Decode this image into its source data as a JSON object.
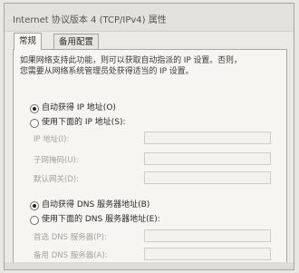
{
  "window": {
    "title": "Internet 协议版本 4 (TCP/IPv4) 属性"
  },
  "tabs": [
    {
      "label": "常规",
      "active": true
    },
    {
      "label": "备用配置",
      "active": false
    }
  ],
  "description": "如果网络支持此功能，则可以获取自动指派的 IP 设置。否则，\n您需要从网络系统管理员处获得适当的 IP 设置。",
  "ip": {
    "auto_label": "自动获得 IP 地址(O)",
    "auto_checked": true,
    "manual_label": "使用下面的 IP 地址(S):",
    "manual_checked": false,
    "fields": [
      {
        "label": "IP 地址(I):"
      },
      {
        "label": "子网掩码(U):"
      },
      {
        "label": "默认网关(D):"
      }
    ]
  },
  "dns": {
    "auto_label": "自动获得 DNS 服务器地址(B)",
    "auto_checked": true,
    "manual_label": "使用下面的 DNS 服务器地址(E):",
    "manual_checked": false,
    "fields": [
      {
        "label": "首选 DNS 服务器(P):"
      },
      {
        "label": "备用 DNS 服务器(A):"
      }
    ]
  }
}
